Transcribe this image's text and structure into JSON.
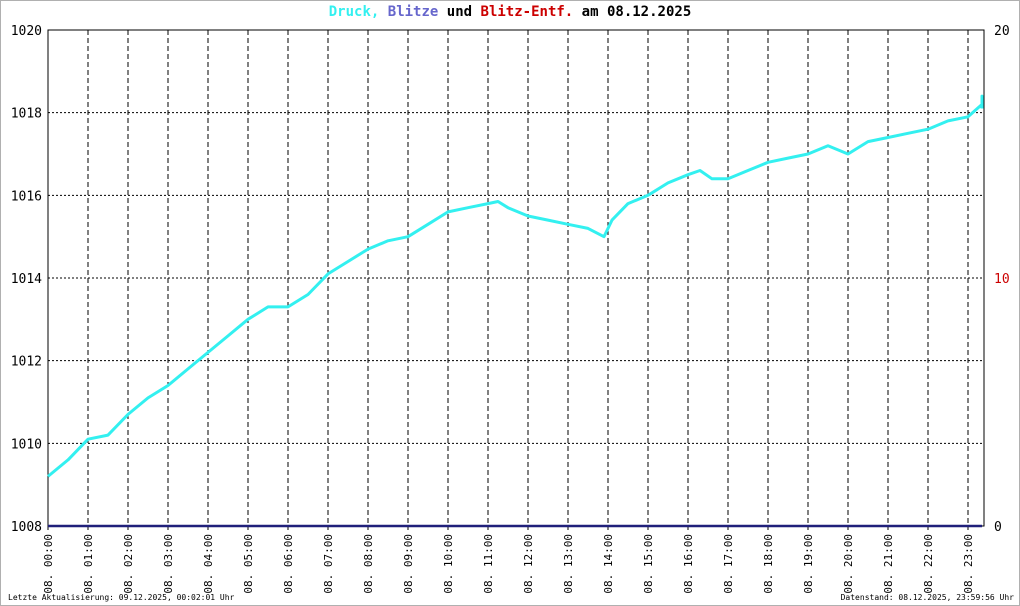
{
  "title": {
    "part1": "Druck,",
    "part2": "Blitze",
    "part3": "und",
    "part4": "Blitz-Entf.",
    "part5": "am 08.12.2025",
    "colors": {
      "druck": "#33f0f0",
      "blitze": "#6666cc",
      "und": "#000000",
      "entf": "#cc0000",
      "date": "#000000"
    }
  },
  "footer": {
    "left": "Letzte Aktualisierung: 09.12.2025, 00:02:01 Uhr",
    "right": "Datenstand: 08.12.2025, 23:59:56 Uhr"
  },
  "chart_data": {
    "type": "line",
    "x_tick_labels": [
      "08. 00:00",
      "08. 01:00",
      "08. 02:00",
      "08. 03:00",
      "08. 04:00",
      "08. 05:00",
      "08. 06:00",
      "08. 07:00",
      "08. 08:00",
      "08. 09:00",
      "08. 10:00",
      "08. 11:00",
      "08. 12:00",
      "08. 13:00",
      "08. 14:00",
      "08. 15:00",
      "08. 16:00",
      "08. 17:00",
      "08. 18:00",
      "08. 19:00",
      "08. 20:00",
      "08. 21:00",
      "08. 22:00",
      "08. 23:00"
    ],
    "y_left": {
      "min": 1008,
      "max": 1020,
      "ticks": [
        "1008",
        "1010",
        "1012",
        "1014",
        "1016",
        "1018",
        "1020"
      ]
    },
    "y_right": {
      "min": 0,
      "max": 20,
      "ticks": [
        "0",
        "10",
        "20"
      ],
      "color": "#cc0000"
    },
    "x_range_hours": [
      0,
      24
    ],
    "series": [
      {
        "name": "Druck",
        "color": "#33f0f0",
        "x_hours": [
          0,
          0.5,
          1,
          1.5,
          2,
          2.5,
          3,
          3.5,
          4,
          4.5,
          5,
          5.5,
          6,
          6.5,
          7,
          7.5,
          8,
          8.5,
          9,
          9.5,
          10,
          10.5,
          11,
          11.25,
          11.5,
          12,
          12.5,
          13,
          13.5,
          13.9,
          14.1,
          14.5,
          15,
          15.5,
          16,
          16.3,
          16.6,
          17,
          17.5,
          18,
          18.5,
          19,
          19.5,
          20,
          20.5,
          21,
          21.5,
          22,
          22.5,
          23,
          23.5,
          23.8,
          24
        ],
        "values": [
          1009.2,
          1009.6,
          1010.1,
          1010.2,
          1010.7,
          1011.1,
          1011.4,
          1011.8,
          1012.2,
          1012.6,
          1013.0,
          1013.3,
          1013.3,
          1013.6,
          1014.1,
          1014.4,
          1014.7,
          1014.9,
          1015.0,
          1015.3,
          1015.6,
          1015.7,
          1015.8,
          1015.85,
          1015.7,
          1015.5,
          1015.4,
          1015.3,
          1015.2,
          1015.0,
          1015.4,
          1015.8,
          1016.0,
          1016.3,
          1016.5,
          1016.6,
          1016.4,
          1016.4,
          1016.6,
          1016.8,
          1016.9,
          1017.0,
          1017.2,
          1017.0,
          1017.3,
          1017.4,
          1017.5,
          1017.6,
          1017.8,
          1017.9,
          1018.2,
          1018.4,
          1018.1
        ]
      },
      {
        "name": "Blitze",
        "color": "#20207a",
        "x_hours": [
          0,
          24
        ],
        "values": [
          1008,
          1008
        ]
      }
    ]
  }
}
